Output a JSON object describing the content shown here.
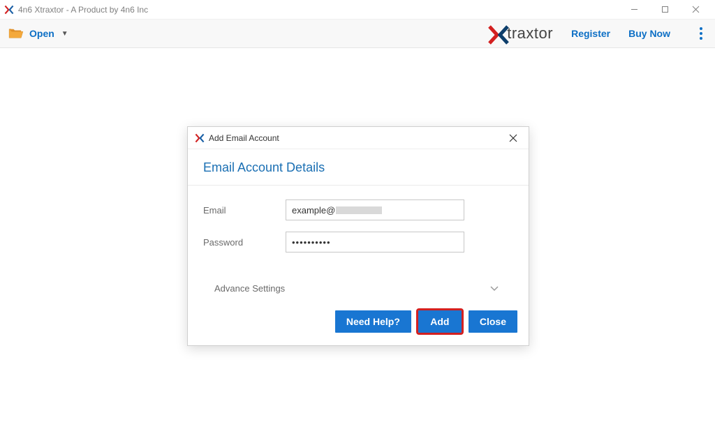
{
  "titlebar": {
    "title": "4n6 Xtraxtor - A Product by 4n6 Inc"
  },
  "toolbar": {
    "open_label": "Open",
    "brand_text": "traxtor",
    "register_label": "Register",
    "buynow_label": "Buy Now"
  },
  "dialog": {
    "title": "Add Email Account",
    "heading": "Email Account Details",
    "email_label": "Email",
    "email_value_visible": "example@",
    "password_label": "Password",
    "password_value": "••••••••••",
    "advance_label": "Advance Settings",
    "buttons": {
      "help": "Need Help?",
      "add": "Add",
      "close": "Close"
    }
  }
}
